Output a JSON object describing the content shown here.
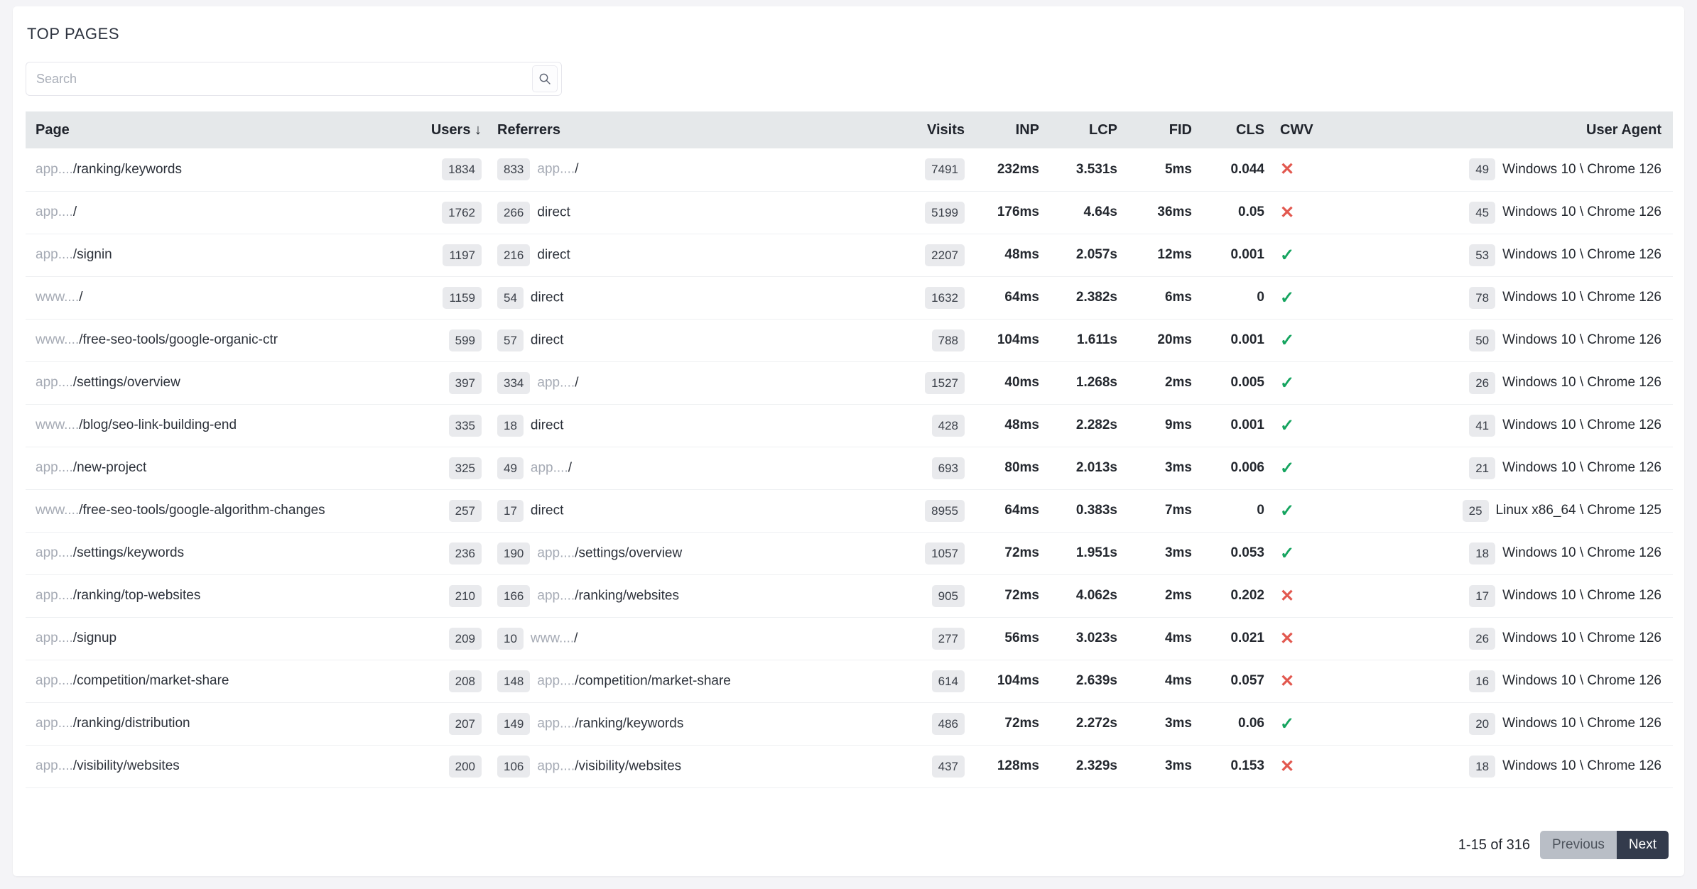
{
  "panel": {
    "title": "TOP PAGES"
  },
  "search": {
    "placeholder": "Search",
    "value": "",
    "icon": "search-icon"
  },
  "table": {
    "columns": {
      "page": "Page",
      "users": "Users ↓",
      "referrers": "Referrers",
      "visits": "Visits",
      "inp": "INP",
      "lcp": "LCP",
      "fid": "FID",
      "cls": "CLS",
      "cwv": "CWV",
      "user_agent": "User Agent"
    },
    "rows": [
      {
        "page_host": "app....",
        "page_path": "/ranking/keywords",
        "users": "1834",
        "ref_count": "833",
        "ref_host": "app....",
        "ref_path": "/",
        "visits": "7491",
        "inp": "232ms",
        "inp_state": "warn",
        "lcp": "3.531s",
        "lcp_state": "warn",
        "fid": "5ms",
        "fid_state": "good",
        "cls": "0.044",
        "cls_state": "good",
        "cwv": "fail",
        "ua_count": "49",
        "ua": "Windows 10 \\ Chrome 126"
      },
      {
        "page_host": "app....",
        "page_path": "/",
        "users": "1762",
        "ref_count": "266",
        "ref_host": "",
        "ref_path": "direct",
        "visits": "5199",
        "inp": "176ms",
        "inp_state": "good",
        "lcp": "4.64s",
        "lcp_state": "bad",
        "fid": "36ms",
        "fid_state": "good",
        "cls": "0.05",
        "cls_state": "good",
        "cwv": "fail",
        "ua_count": "45",
        "ua": "Windows 10 \\ Chrome 126"
      },
      {
        "page_host": "app....",
        "page_path": "/signin",
        "users": "1197",
        "ref_count": "216",
        "ref_host": "",
        "ref_path": "direct",
        "visits": "2207",
        "inp": "48ms",
        "inp_state": "good",
        "lcp": "2.057s",
        "lcp_state": "good",
        "fid": "12ms",
        "fid_state": "good",
        "cls": "0.001",
        "cls_state": "good",
        "cwv": "pass",
        "ua_count": "53",
        "ua": "Windows 10 \\ Chrome 126"
      },
      {
        "page_host": "www....",
        "page_path": "/",
        "users": "1159",
        "ref_count": "54",
        "ref_host": "",
        "ref_path": "direct",
        "visits": "1632",
        "inp": "64ms",
        "inp_state": "good",
        "lcp": "2.382s",
        "lcp_state": "good",
        "fid": "6ms",
        "fid_state": "good",
        "cls": "0",
        "cls_state": "good",
        "cwv": "pass",
        "ua_count": "78",
        "ua": "Windows 10 \\ Chrome 126"
      },
      {
        "page_host": "www....",
        "page_path": "/free-seo-tools/google-organic-ctr",
        "users": "599",
        "ref_count": "57",
        "ref_host": "",
        "ref_path": "direct",
        "visits": "788",
        "inp": "104ms",
        "inp_state": "good",
        "lcp": "1.611s",
        "lcp_state": "good",
        "fid": "20ms",
        "fid_state": "good",
        "cls": "0.001",
        "cls_state": "good",
        "cwv": "pass",
        "ua_count": "50",
        "ua": "Windows 10 \\ Chrome 126"
      },
      {
        "page_host": "app....",
        "page_path": "/settings/overview",
        "users": "397",
        "ref_count": "334",
        "ref_host": "app....",
        "ref_path": "/",
        "visits": "1527",
        "inp": "40ms",
        "inp_state": "good",
        "lcp": "1.268s",
        "lcp_state": "good",
        "fid": "2ms",
        "fid_state": "good",
        "cls": "0.005",
        "cls_state": "good",
        "cwv": "pass",
        "ua_count": "26",
        "ua": "Windows 10 \\ Chrome 126"
      },
      {
        "page_host": "www....",
        "page_path": "/blog/seo-link-building-end",
        "users": "335",
        "ref_count": "18",
        "ref_host": "",
        "ref_path": "direct",
        "visits": "428",
        "inp": "48ms",
        "inp_state": "good",
        "lcp": "2.282s",
        "lcp_state": "good",
        "fid": "9ms",
        "fid_state": "good",
        "cls": "0.001",
        "cls_state": "good",
        "cwv": "pass",
        "ua_count": "41",
        "ua": "Windows 10 \\ Chrome 126"
      },
      {
        "page_host": "app....",
        "page_path": "/new-project",
        "users": "325",
        "ref_count": "49",
        "ref_host": "app....",
        "ref_path": "/",
        "visits": "693",
        "inp": "80ms",
        "inp_state": "good",
        "lcp": "2.013s",
        "lcp_state": "good",
        "fid": "3ms",
        "fid_state": "good",
        "cls": "0.006",
        "cls_state": "good",
        "cwv": "pass",
        "ua_count": "21",
        "ua": "Windows 10 \\ Chrome 126"
      },
      {
        "page_host": "www....",
        "page_path": "/free-seo-tools/google-algorithm-changes",
        "users": "257",
        "ref_count": "17",
        "ref_host": "",
        "ref_path": "direct",
        "visits": "8955",
        "inp": "64ms",
        "inp_state": "good",
        "lcp": "0.383s",
        "lcp_state": "good",
        "fid": "7ms",
        "fid_state": "good",
        "cls": "0",
        "cls_state": "good",
        "cwv": "pass",
        "ua_count": "25",
        "ua": "Linux x86_64 \\ Chrome 125"
      },
      {
        "page_host": "app....",
        "page_path": "/settings/keywords",
        "users": "236",
        "ref_count": "190",
        "ref_host": "app....",
        "ref_path": "/settings/overview",
        "visits": "1057",
        "inp": "72ms",
        "inp_state": "good",
        "lcp": "1.951s",
        "lcp_state": "good",
        "fid": "3ms",
        "fid_state": "good",
        "cls": "0.053",
        "cls_state": "good",
        "cwv": "pass",
        "ua_count": "18",
        "ua": "Windows 10 \\ Chrome 126"
      },
      {
        "page_host": "app....",
        "page_path": "/ranking/top-websites",
        "users": "210",
        "ref_count": "166",
        "ref_host": "app....",
        "ref_path": "/ranking/websites",
        "visits": "905",
        "inp": "72ms",
        "inp_state": "good",
        "lcp": "4.062s",
        "lcp_state": "bad",
        "fid": "2ms",
        "fid_state": "good",
        "cls": "0.202",
        "cls_state": "warn",
        "cwv": "fail",
        "ua_count": "17",
        "ua": "Windows 10 \\ Chrome 126"
      },
      {
        "page_host": "app....",
        "page_path": "/signup",
        "users": "209",
        "ref_count": "10",
        "ref_host": "www....",
        "ref_path": "/",
        "visits": "277",
        "inp": "56ms",
        "inp_state": "good",
        "lcp": "3.023s",
        "lcp_state": "warn",
        "fid": "4ms",
        "fid_state": "good",
        "cls": "0.021",
        "cls_state": "good",
        "cwv": "fail",
        "ua_count": "26",
        "ua": "Windows 10 \\ Chrome 126"
      },
      {
        "page_host": "app....",
        "page_path": "/competition/market-share",
        "users": "208",
        "ref_count": "148",
        "ref_host": "app....",
        "ref_path": "/competition/market-share",
        "visits": "614",
        "inp": "104ms",
        "inp_state": "good",
        "lcp": "2.639s",
        "lcp_state": "warn",
        "fid": "4ms",
        "fid_state": "good",
        "cls": "0.057",
        "cls_state": "good",
        "cwv": "fail",
        "ua_count": "16",
        "ua": "Windows 10 \\ Chrome 126"
      },
      {
        "page_host": "app....",
        "page_path": "/ranking/distribution",
        "users": "207",
        "ref_count": "149",
        "ref_host": "app....",
        "ref_path": "/ranking/keywords",
        "visits": "486",
        "inp": "72ms",
        "inp_state": "good",
        "lcp": "2.272s",
        "lcp_state": "good",
        "fid": "3ms",
        "fid_state": "good",
        "cls": "0.06",
        "cls_state": "good",
        "cwv": "pass",
        "ua_count": "20",
        "ua": "Windows 10 \\ Chrome 126"
      },
      {
        "page_host": "app....",
        "page_path": "/visibility/websites",
        "users": "200",
        "ref_count": "106",
        "ref_host": "app....",
        "ref_path": "/visibility/websites",
        "visits": "437",
        "inp": "128ms",
        "inp_state": "good",
        "lcp": "2.329s",
        "lcp_state": "good",
        "fid": "3ms",
        "fid_state": "good",
        "cls": "0.153",
        "cls_state": "warn",
        "cwv": "fail",
        "ua_count": "18",
        "ua": "Windows 10 \\ Chrome 126"
      }
    ]
  },
  "footer": {
    "range": "1-15 of 316",
    "previous_label": "Previous",
    "next_label": "Next"
  },
  "colors": {
    "good": "#12965a",
    "warn": "#eea10b",
    "bad": "#e0362c",
    "cwv_pass": "#15a45f",
    "cwv_fail": "#e2584f",
    "header_bg": "#e5e8ea",
    "chip_bg": "#e9eaed",
    "next_bg": "#333b4c",
    "prev_bg": "#b9bec6"
  },
  "icons": {
    "search": "search-icon",
    "cwv_pass": "check-icon",
    "cwv_fail": "cross-icon",
    "sort_desc": "arrow-down-icon"
  }
}
